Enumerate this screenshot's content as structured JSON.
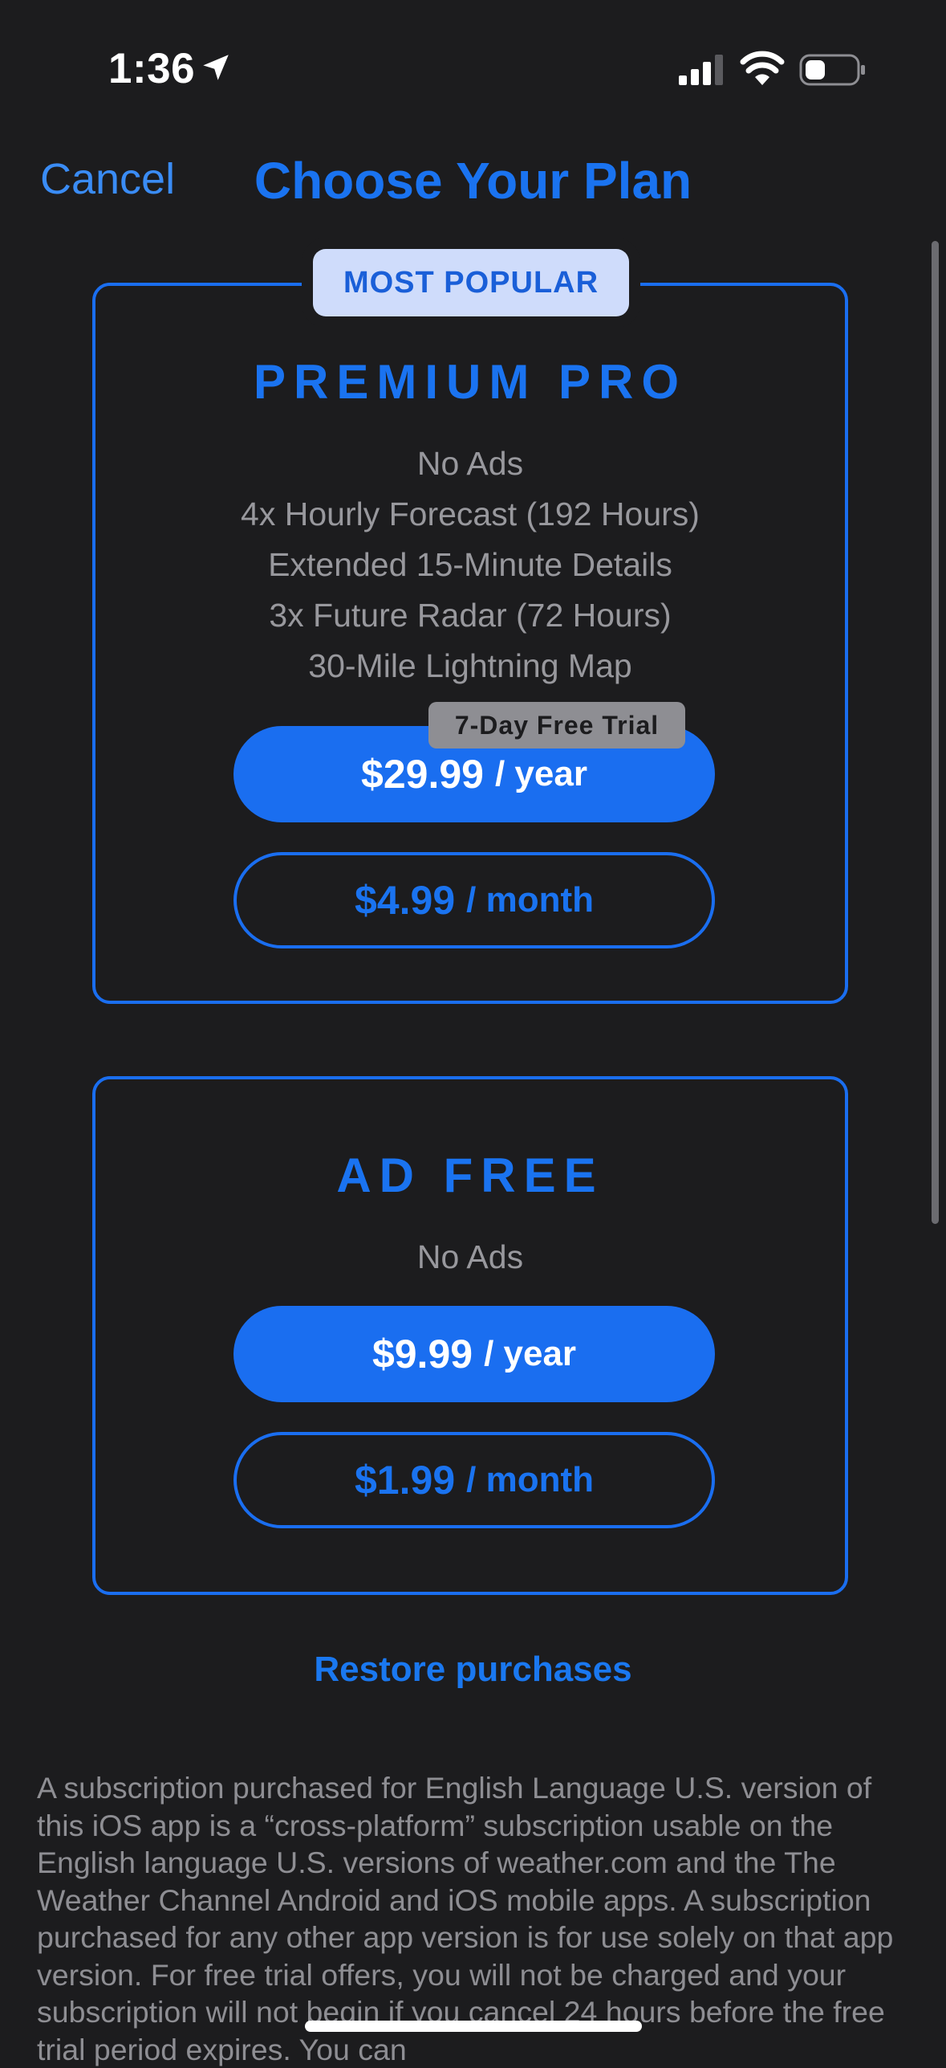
{
  "status_bar": {
    "time": "1:36",
    "icons": [
      "location-arrow-icon",
      "cellular-signal-icon",
      "wifi-icon",
      "battery-icon"
    ]
  },
  "nav": {
    "cancel_label": "Cancel",
    "title": "Choose Your Plan"
  },
  "plans": [
    {
      "badge": "MOST POPULAR",
      "name": "PREMIUM PRO",
      "features": [
        "No Ads",
        "4x Hourly Forecast (192 Hours)",
        "Extended 15-Minute Details",
        "3x Future Radar (72 Hours)",
        "30-Mile Lightning Map"
      ],
      "trial_badge": "7-Day Free Trial",
      "yearly": {
        "amount": "$29.99",
        "period": "/ year"
      },
      "monthly": {
        "amount": "$4.99",
        "period": "/ month"
      }
    },
    {
      "name": "AD FREE",
      "features": [
        "No Ads"
      ],
      "yearly": {
        "amount": "$9.99",
        "period": "/ year"
      },
      "monthly": {
        "amount": "$1.99",
        "period": "/ month"
      }
    }
  ],
  "restore_label": "Restore purchases",
  "disclaimer": "A subscription purchased for English Language U.S. version of this iOS app is a “cross-platform” subscription usable on the English language U.S. versions of weather.com and the The Weather Channel Android and iOS mobile apps. A subscription purchased for any other app version is for use solely on that app version. For free trial offers, you will not be charged and your subscription will not begin if you cancel 24 hours before the free trial period expires. You can",
  "colors": {
    "background": "#1c1c1e",
    "accent": "#1a6ef0",
    "badge_bg": "#cfdcfb",
    "muted_text": "#8e8e93"
  }
}
